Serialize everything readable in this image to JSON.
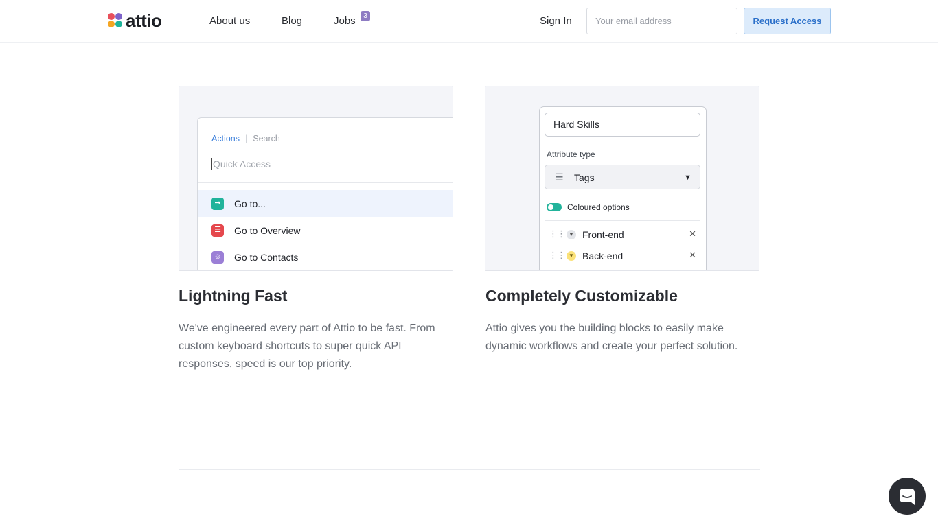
{
  "header": {
    "logo_text": "attio",
    "nav": {
      "about": "About us",
      "blog": "Blog",
      "jobs": "Jobs",
      "jobs_badge": "3"
    },
    "sign_in": "Sign In",
    "email_placeholder": "Your email address",
    "request_access": "Request Access"
  },
  "features": [
    {
      "title": "Lightning Fast",
      "description": "We've engineered every part of Attio to be fast. From custom keyboard shortcuts to super quick API responses, speed is our top priority.",
      "mock": {
        "tab_active": "Actions",
        "tab_inactive": "Search",
        "query_placeholder": "Quick Access",
        "items": [
          {
            "label": "Go to...",
            "icon": "arrow-right-icon",
            "color": "#21b39b"
          },
          {
            "label": "Go to Overview",
            "icon": "list-icon",
            "color": "#e5484d"
          },
          {
            "label": "Go to Contacts",
            "icon": "person-icon",
            "color": "#9b7fd6"
          }
        ]
      }
    },
    {
      "title": "Completely Customizable",
      "description": "Attio gives you the building blocks to easily make dynamic workflows and create your perfect solution.",
      "mock": {
        "attribute_name": "Hard Skills",
        "type_label": "Attribute type",
        "type_value": "Tags",
        "toggle_label": "Coloured options",
        "toggle_on": true,
        "options": [
          {
            "name": "Front-end",
            "color": "#e3e5e9"
          },
          {
            "name": "Back-end",
            "color": "#fbe27a"
          }
        ]
      }
    }
  ],
  "colors": {
    "accent": "#2a6fc9",
    "button_bg": "#dcebfb",
    "teal": "#21b39b",
    "red": "#e5484d",
    "purple": "#9b7fd6",
    "chat_button": "#2b2d33"
  },
  "chat_button_icon": "chat-icon"
}
